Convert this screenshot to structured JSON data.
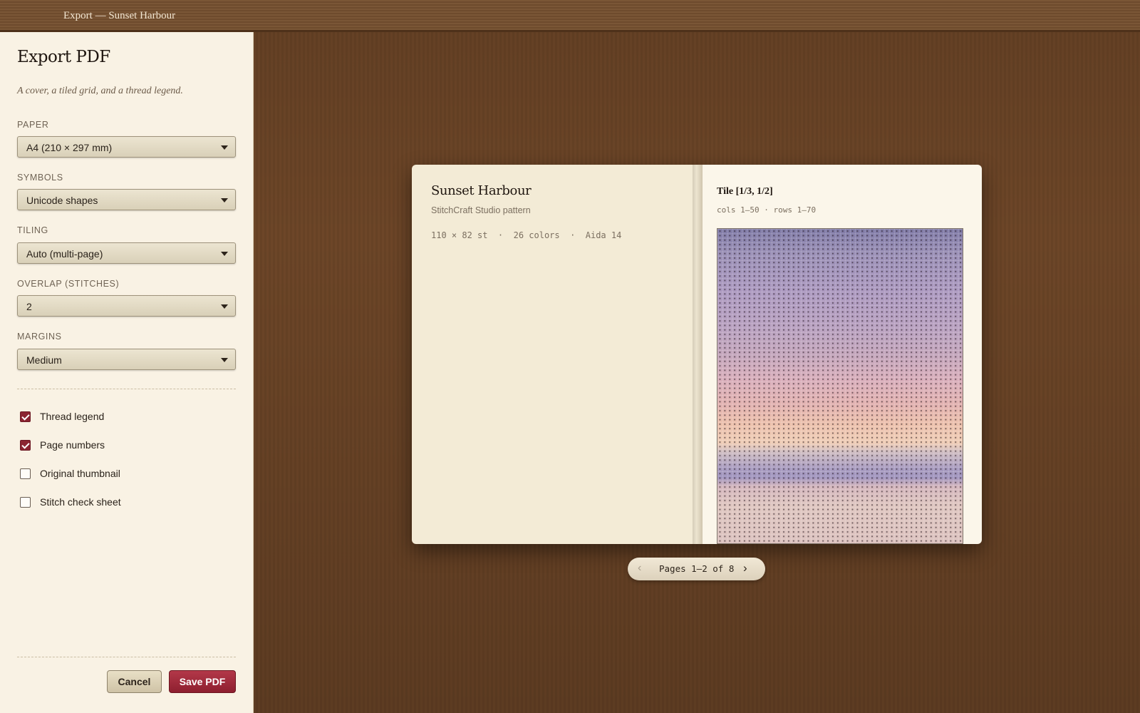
{
  "window": {
    "title": "Export — Sunset Harbour"
  },
  "sidebar": {
    "heading": "Export PDF",
    "subtitle": "A cover, a tiled grid, and a thread legend.",
    "fields": [
      {
        "label": "PAPER",
        "value": "A4 (210 × 297 mm)"
      },
      {
        "label": "SYMBOLS",
        "value": "Unicode shapes"
      },
      {
        "label": "TILING",
        "value": "Auto (multi-page)"
      },
      {
        "label": "OVERLAP (STITCHES)",
        "value": "2"
      },
      {
        "label": "MARGINS",
        "value": "Medium"
      }
    ],
    "options": [
      {
        "label": "Thread legend",
        "checked": true
      },
      {
        "label": "Page numbers",
        "checked": true
      },
      {
        "label": "Original thumbnail",
        "checked": false
      },
      {
        "label": "Stitch check sheet",
        "checked": false
      }
    ],
    "cancel_label": "Cancel",
    "save_label": "Save PDF"
  },
  "preview": {
    "cover": {
      "title": "Sunset Harbour",
      "subtitle": "StitchCraft Studio pattern",
      "meta": "110 × 82 st  ·  26 colors  ·  Aida 14"
    },
    "tile": {
      "title": "Tile [1/3, 1/2]",
      "range": "cols 1–50 · rows 1–70"
    },
    "pager": {
      "prev_icon": "‹",
      "label": "Pages 1–2 of 8",
      "next_icon": "›"
    }
  }
}
